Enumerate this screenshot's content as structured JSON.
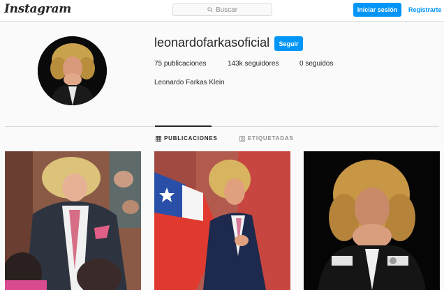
{
  "nav": {
    "logo": "Instagram",
    "search_placeholder": "Buscar",
    "login_label": "Iniciar sesión",
    "register_label": "Registrarte"
  },
  "profile": {
    "username": "leonardofarkasoficial",
    "follow_label": "Seguir",
    "stats": {
      "posts": "75 publicaciones",
      "followers": "143k seguidores",
      "following": "0 seguidos"
    },
    "full_name": "Leonardo Farkas Klein"
  },
  "tabs": [
    {
      "label": "PUBLICACIONES",
      "icon": "grid-icon",
      "active": true
    },
    {
      "label": "ETIQUETADAS",
      "icon": "tagged-icon",
      "active": false
    }
  ],
  "posts": [
    {
      "icon": "photo-man-pink-tie"
    },
    {
      "icon": "photo-man-chilean-flag"
    },
    {
      "icon": "photo-man-hands-clasped"
    }
  ],
  "colors": {
    "accent": "#0095f6",
    "text": "#262626",
    "muted": "#8e8e8e",
    "border": "#dbdbdb",
    "background": "#fafafa"
  }
}
